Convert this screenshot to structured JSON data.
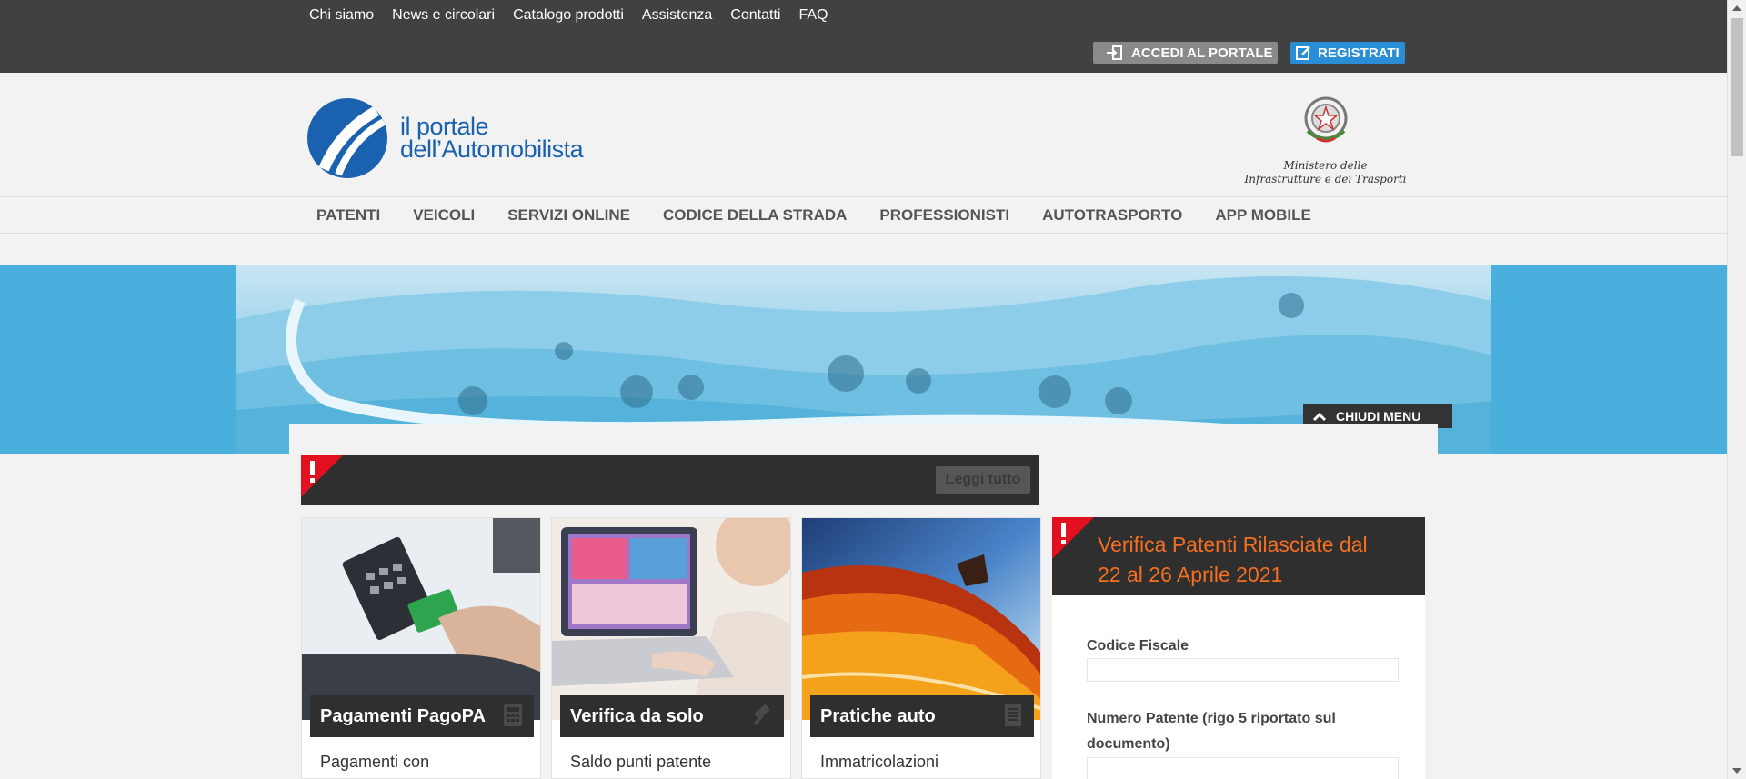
{
  "topbar": {
    "links": [
      "Chi siamo",
      "News e circolari",
      "Catalogo prodotti",
      "Assistenza",
      "Contatti",
      "FAQ"
    ],
    "portal_button": "ACCEDI AL PORTALE",
    "register_button": "REGISTRATI"
  },
  "header": {
    "logo_line1": "il portale",
    "logo_line2": "dell’Automobilista",
    "ministry_line1": "Ministero delle",
    "ministry_line2": "Infrastrutture e dei Trasporti"
  },
  "nav": {
    "items": [
      "PATENTI",
      "VEICOLI",
      "SERVIZI ONLINE",
      "CODICE DELLA STRADA",
      "PROFESSIONISTI",
      "AUTOTRASPORTO",
      "APP MOBILE"
    ]
  },
  "banner": {
    "close_menu": "CHIUDI MENU"
  },
  "alert": {
    "read_more": "Leggi tutto"
  },
  "cards": [
    {
      "title": "Pagamenti PagoPA",
      "desc": "Pagamenti con"
    },
    {
      "title": "Verifica da solo",
      "desc": "Saldo punti patente"
    },
    {
      "title": "Pratiche auto",
      "desc": "Immatricolazioni"
    }
  ],
  "sidebox": {
    "title_line1": "Verifica Patenti Rilasciate dal",
    "title_line2": "22 al 26 Aprile 2021",
    "field1_label": "Codice Fiscale",
    "field2_label_line1": "Numero Patente (rigo 5 riportato sul",
    "field2_label_line2": "documento)"
  },
  "colors": {
    "topbar": "#414141",
    "brand_blue": "#1a62b0",
    "banner": "#49afdc",
    "register": "#2a8ed6",
    "accent_orange": "#f36f21",
    "alert_red": "#e3101f"
  }
}
